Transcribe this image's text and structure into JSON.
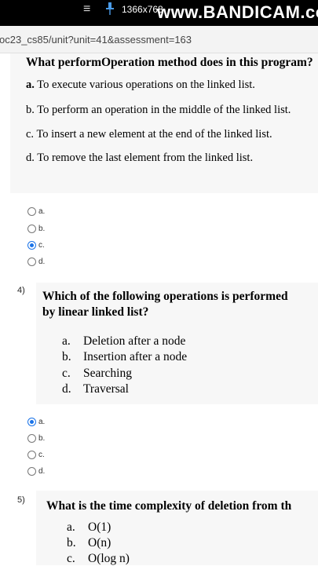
{
  "overlay": {
    "menu_icon": "≡",
    "pin_icon": "pin",
    "resolution": "1366x768",
    "watermark": "www.BANDICAM.co"
  },
  "browser": {
    "url": "oc23_cs85/unit?unit=41&assessment=163"
  },
  "q3": {
    "question": "What performOperation method does in this program?",
    "options": [
      {
        "letter": "a.",
        "text": "To execute various operations on the linked list."
      },
      {
        "letter": "b.",
        "text": "To perform an operation in the middle of the linked list."
      },
      {
        "letter": "c.",
        "text": "To insert a new element at the end of the linked list."
      },
      {
        "letter": "d.",
        "text": "To remove the last element from the linked list."
      }
    ],
    "choices": [
      {
        "label": "a.",
        "selected": false
      },
      {
        "label": "b.",
        "selected": false
      },
      {
        "label": "c.",
        "selected": true
      },
      {
        "label": "d.",
        "selected": false
      }
    ]
  },
  "q4": {
    "number": "4)",
    "question_line1": "Which of the following operations is performed",
    "question_line2": "by linear linked list?",
    "options": [
      {
        "letter": "a.",
        "text": "Deletion after a node"
      },
      {
        "letter": "b.",
        "text": "Insertion after a node"
      },
      {
        "letter": "c.",
        "text": "Searching"
      },
      {
        "letter": "d.",
        "text": "Traversal"
      }
    ],
    "choices": [
      {
        "label": "a.",
        "selected": true
      },
      {
        "label": "b.",
        "selected": false
      },
      {
        "label": "c.",
        "selected": false
      },
      {
        "label": "d.",
        "selected": false
      }
    ]
  },
  "q5": {
    "number": "5)",
    "question": "What is the time complexity of deletion from th",
    "options": [
      {
        "letter": "a.",
        "text": "O(1)"
      },
      {
        "letter": "b.",
        "text": "O(n)"
      },
      {
        "letter": "c.",
        "text": "O(log n)"
      }
    ]
  }
}
